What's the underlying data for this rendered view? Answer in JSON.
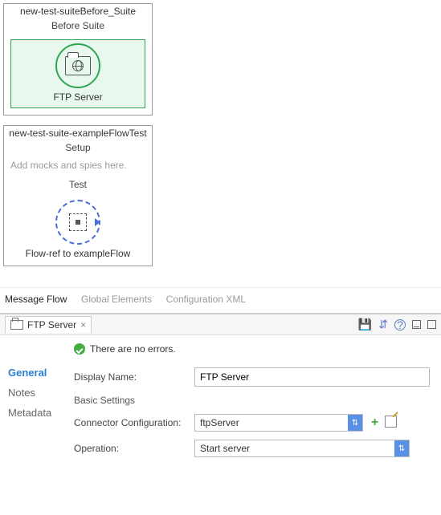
{
  "canvas": {
    "box1": {
      "title": "new-test-suiteBefore_Suite",
      "sub": "Before Suite",
      "node_label": "FTP Server"
    },
    "box2": {
      "title": "new-test-suite-exampleFlowTest",
      "sub_setup": "Setup",
      "hint": "Add mocks and spies here.",
      "sub_test": "Test",
      "node_label": "Flow-ref to exampleFlow"
    }
  },
  "view_tabs": {
    "message_flow": "Message Flow",
    "global_elements": "Global Elements",
    "config_xml": "Configuration XML"
  },
  "panel": {
    "tab_label": "FTP Server",
    "status_text": "There are no errors.",
    "side": {
      "general": "General",
      "notes": "Notes",
      "metadata": "Metadata"
    },
    "form": {
      "display_name_label": "Display Name:",
      "display_name_value": "FTP Server",
      "basic_settings": "Basic Settings",
      "connector_label": "Connector Configuration:",
      "connector_value": "ftpServer",
      "operation_label": "Operation:",
      "operation_value": "Start server"
    }
  }
}
